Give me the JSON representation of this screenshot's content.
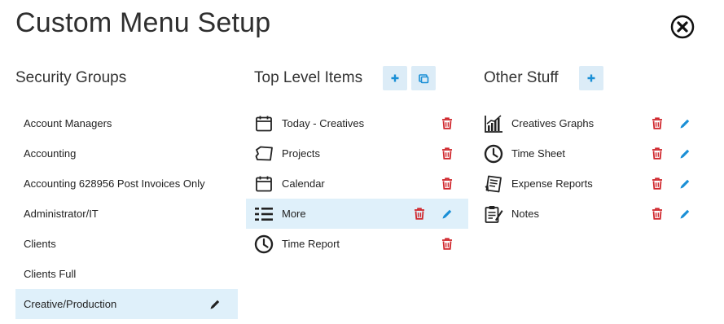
{
  "title": "Custom Menu Setup",
  "colors": {
    "accent": "#1a8fd6",
    "delete": "#d0282e",
    "selected_bg": "#dff0fa",
    "button_bg": "#dcecf7"
  },
  "security_groups": {
    "heading": "Security Groups",
    "items": [
      {
        "label": "Account Managers"
      },
      {
        "label": "Accounting"
      },
      {
        "label": "Accounting 628956 Post Invoices Only"
      },
      {
        "label": "Administrator/IT"
      },
      {
        "label": "Clients"
      },
      {
        "label": "Clients Full"
      },
      {
        "label": "Creative/Production",
        "selected": true,
        "editable": true
      }
    ]
  },
  "top_level": {
    "heading": "Top Level Items",
    "items": [
      {
        "label": "Today - Creatives",
        "icon": "calendar-icon"
      },
      {
        "label": "Projects",
        "icon": "folder-shape-icon"
      },
      {
        "label": "Calendar",
        "icon": "calendar-icon"
      },
      {
        "label": "More",
        "icon": "list-icon",
        "selected": true
      },
      {
        "label": "Time Report",
        "icon": "clock-icon"
      }
    ]
  },
  "other_stuff": {
    "heading": "Other Stuff",
    "items": [
      {
        "label": "Creatives Graphs",
        "icon": "bar-chart-icon"
      },
      {
        "label": "Time Sheet",
        "icon": "clock-icon"
      },
      {
        "label": "Expense Reports",
        "icon": "receipt-icon"
      },
      {
        "label": "Notes",
        "icon": "clipboard-icon"
      }
    ]
  }
}
